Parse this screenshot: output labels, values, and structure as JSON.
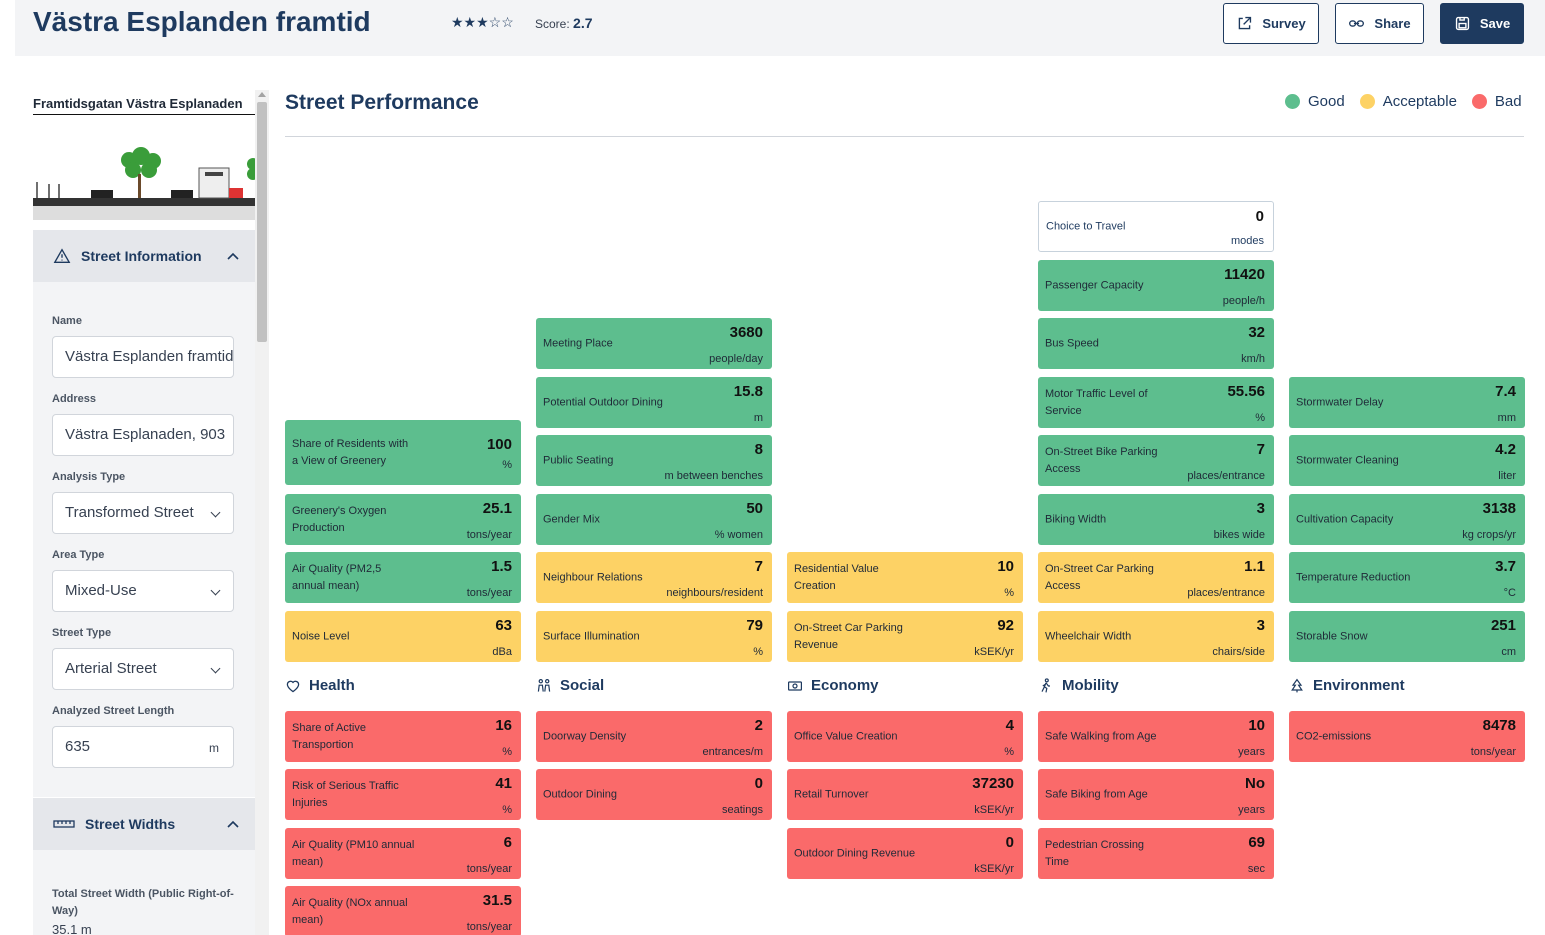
{
  "header": {
    "title": "Västra Esplanden framtid",
    "stars": "★★★☆☆",
    "score_label": "Score:",
    "score_value": "2.7",
    "survey_label": "Survey",
    "share_label": "Share",
    "save_label": "Save"
  },
  "sidebar": {
    "street_name": "Framtidsgatan Västra Esplanaden",
    "street_info_title": "Street Information",
    "street_widths_title": "Street Widths",
    "fields": {
      "name_label": "Name",
      "name_value": "Västra Esplanden framtid",
      "address_label": "Address",
      "address_value": "Västra Esplanaden, 903",
      "analysis_label": "Analysis Type",
      "analysis_value": "Transformed Street",
      "area_label": "Area Type",
      "area_value": "Mixed-Use",
      "street_type_label": "Street Type",
      "street_type_value": "Arterial Street",
      "length_label": "Analyzed Street Length",
      "length_value": "635",
      "length_unit": "m"
    },
    "widths": {
      "total_label": "Total Street Width (Public Right-of-Way)",
      "total_value": "35.1 m"
    }
  },
  "main": {
    "title": "Street Performance",
    "legend": {
      "good": "Good",
      "acceptable": "Acceptable",
      "bad": "Bad"
    },
    "colors": {
      "good": "#5dbe8e",
      "acceptable": "#fdd265",
      "bad": "#fa6a6a",
      "accent": "#1e3a5f"
    },
    "categories": {
      "health": "Health",
      "social": "Social",
      "economy": "Economy",
      "mobility": "Mobility",
      "environment": "Environment"
    },
    "cards": {
      "choice_travel": {
        "label": "Choice to Travel",
        "value": "0",
        "unit": "modes"
      },
      "passenger_capacity": {
        "label": "Passenger Capacity",
        "value": "11420",
        "unit": "people/h"
      },
      "meeting_place": {
        "label": "Meeting Place",
        "value": "3680",
        "unit": "people/day"
      },
      "bus_speed": {
        "label": "Bus Speed",
        "value": "32",
        "unit": "km/h"
      },
      "outdoor_dining_potential": {
        "label": "Potential Outdoor Dining",
        "value": "15.8",
        "unit": "m"
      },
      "motor_traffic": {
        "label": "Motor Traffic Level of Service",
        "value": "55.56",
        "unit": "%"
      },
      "stormwater_delay": {
        "label": "Stormwater Delay",
        "value": "7.4",
        "unit": "mm"
      },
      "share_greenery": {
        "label": "Share of Residents with a View of Greenery",
        "value": "100",
        "unit": "%"
      },
      "public_seating": {
        "label": "Public Seating",
        "value": "8",
        "unit": "m between benches"
      },
      "bike_parking": {
        "label": "On-Street Bike Parking Access",
        "value": "7",
        "unit": "places/entrance"
      },
      "stormwater_cleaning": {
        "label": "Stormwater Cleaning",
        "value": "4.2",
        "unit": "liter"
      },
      "oxygen": {
        "label": "Greenery's Oxygen Production",
        "value": "25.1",
        "unit": "tons/year"
      },
      "gender_mix": {
        "label": "Gender Mix",
        "value": "50",
        "unit": "% women"
      },
      "biking_width": {
        "label": "Biking Width",
        "value": "3",
        "unit": "bikes wide"
      },
      "cultivation": {
        "label": "Cultivation Capacity",
        "value": "3138",
        "unit": "kg crops/yr"
      },
      "air_pm25": {
        "label": "Air Quality (PM2,5 annual mean)",
        "value": "1.5",
        "unit": "tons/year"
      },
      "neighbour": {
        "label": "Neighbour Relations",
        "value": "7",
        "unit": "neighbours/resident"
      },
      "residential_value": {
        "label": "Residential Value Creation",
        "value": "10",
        "unit": "%"
      },
      "car_parking": {
        "label": "On-Street Car Parking Access",
        "value": "1.1",
        "unit": "places/entrance"
      },
      "temperature": {
        "label": "Temperature Reduction",
        "value": "3.7",
        "unit": "°C"
      },
      "noise": {
        "label": "Noise Level",
        "value": "63",
        "unit": "dBa"
      },
      "illumination": {
        "label": "Surface Illumination",
        "value": "79",
        "unit": "%"
      },
      "parking_revenue": {
        "label": "On-Street Car Parking Revenue",
        "value": "92",
        "unit": "kSEK/yr"
      },
      "wheelchair": {
        "label": "Wheelchair Width",
        "value": "3",
        "unit": "chairs/side"
      },
      "snow": {
        "label": "Storable Snow",
        "value": "251",
        "unit": "cm"
      },
      "active_transport": {
        "label": "Share of Active Transportion",
        "value": "16",
        "unit": "%"
      },
      "doorway": {
        "label": "Doorway Density",
        "value": "2",
        "unit": "entrances/m"
      },
      "office_value": {
        "label": "Office Value Creation",
        "value": "4",
        "unit": "%"
      },
      "safe_walking": {
        "label": "Safe Walking from Age",
        "value": "10",
        "unit": "years"
      },
      "co2": {
        "label": "CO2-emissions",
        "value": "8478",
        "unit": "tons/year"
      },
      "traffic_injuries": {
        "label": "Risk of Serious Traffic Injuries",
        "value": "41",
        "unit": "%"
      },
      "outdoor_dining": {
        "label": "Outdoor Dining",
        "value": "0",
        "unit": "seatings"
      },
      "retail": {
        "label": "Retail Turnover",
        "value": "37230",
        "unit": "kSEK/yr"
      },
      "safe_biking": {
        "label": "Safe Biking from Age",
        "value": "No",
        "unit": "years"
      },
      "air_pm10": {
        "label": "Air Quality (PM10 annual mean)",
        "value": "6",
        "unit": "tons/year"
      },
      "dining_revenue": {
        "label": "Outdoor Dining Revenue",
        "value": "0",
        "unit": "kSEK/yr"
      },
      "pedestrian_crossing": {
        "label": "Pedestrian Crossing Time",
        "value": "69",
        "unit": "sec"
      },
      "air_nox": {
        "label": "Air Quality (NOx annual mean)",
        "value": "31.5",
        "unit": "tons/year"
      }
    }
  }
}
